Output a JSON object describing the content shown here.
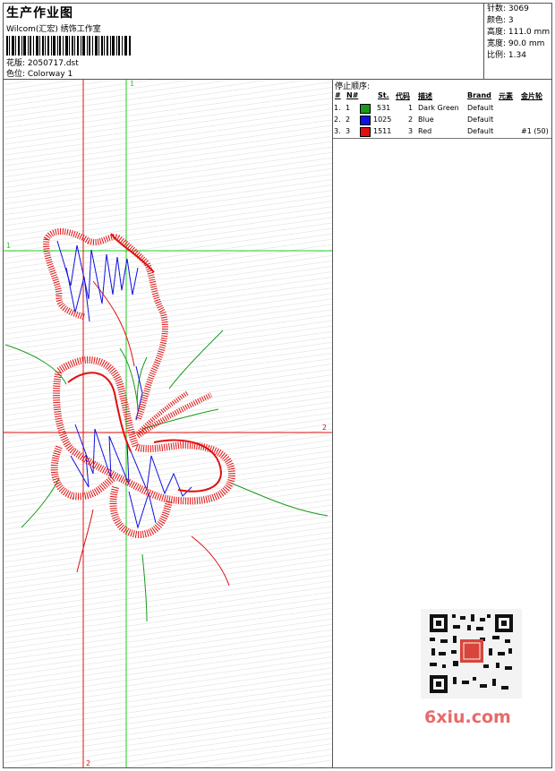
{
  "header": {
    "title": "生产作业图",
    "studio": "Wilcom(汇宏) 绣饰工作室",
    "design_label": "花版: 2050717.dst",
    "colorway_label": "色位:  Colorway 1"
  },
  "stats": [
    {
      "label": "针数:",
      "value": "3069"
    },
    {
      "label": "颜色:",
      "value": "3"
    },
    {
      "label": "高度:",
      "value": "111.0 mm"
    },
    {
      "label": "宽度:",
      "value": "90.0 mm"
    },
    {
      "label": "比例:",
      "value": "1.34"
    }
  ],
  "guides": {
    "vertical_green": "1",
    "horizontal_green": "1",
    "horizontal_red": "2",
    "vertical_red": "2"
  },
  "stop_sequence": {
    "title": "停止顺序:",
    "columns": [
      "#",
      "N#",
      "St.",
      "代码",
      "描述",
      "Brand",
      "元素",
      "金片轮"
    ],
    "rows": [
      {
        "num": "1.",
        "n": "1",
        "color": "#1a9a1a",
        "stitches": "531",
        "code": "1",
        "desc": "Dark Green",
        "brand": "Default",
        "element": ""
      },
      {
        "num": "2.",
        "n": "2",
        "color": "#1010e0",
        "stitches": "1025",
        "code": "2",
        "desc": "Blue",
        "brand": "Default",
        "element": ""
      },
      {
        "num": "3.",
        "n": "3",
        "color": "#e01010",
        "stitches": "1511",
        "code": "3",
        "desc": "Red",
        "brand": "Default",
        "element": "#1 (50)"
      }
    ]
  },
  "watermark": {
    "text": "6xiu.com",
    "qr_label": "6xiu.com"
  },
  "colors": {
    "red": "#e01010",
    "green": "#1a9a1a",
    "blue": "#1010e0"
  }
}
